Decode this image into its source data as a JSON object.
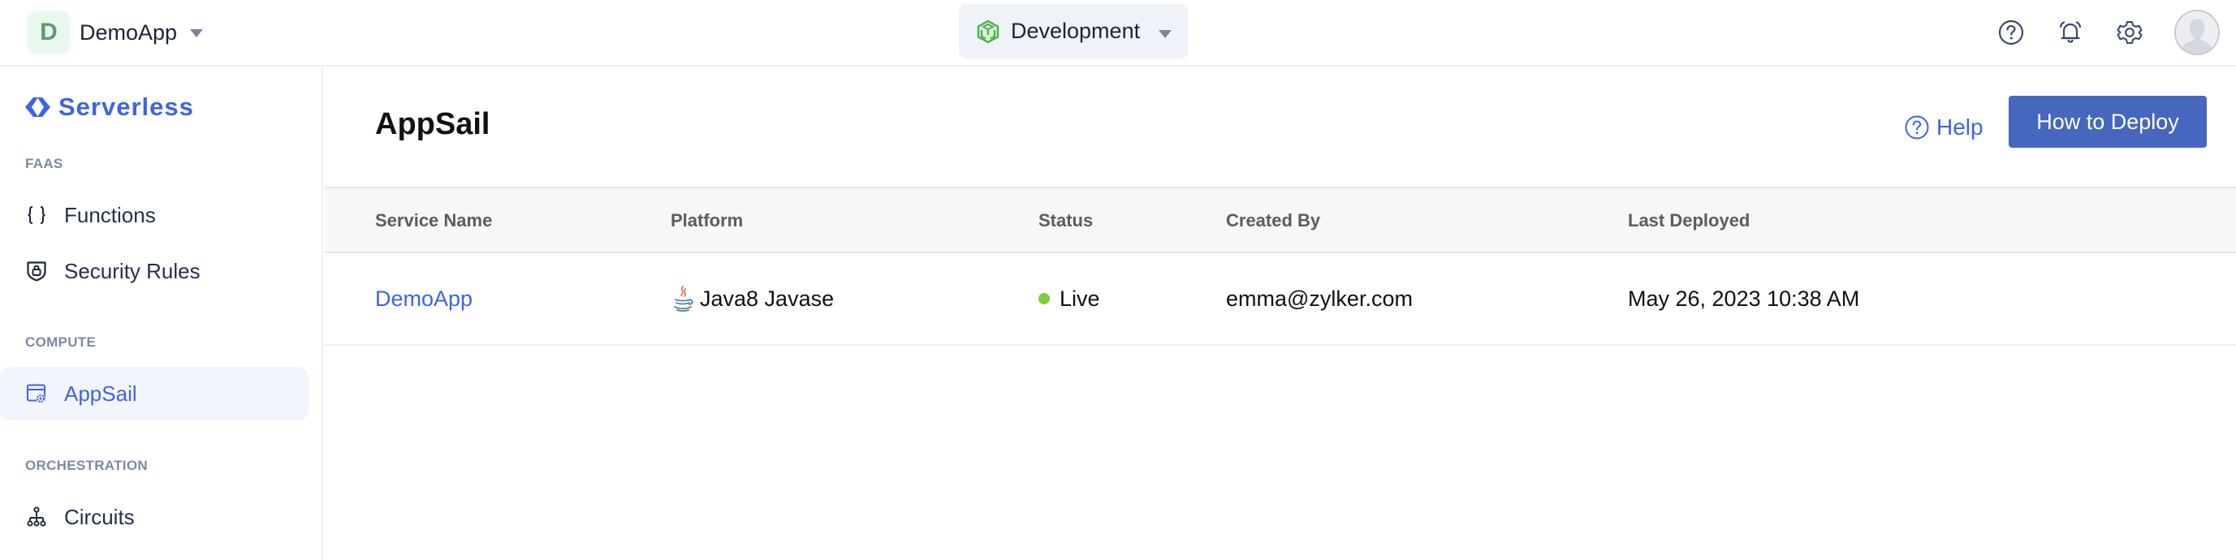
{
  "header": {
    "app_initial": "D",
    "app_name": "DemoApp",
    "environment": "Development",
    "icons": [
      "help-icon",
      "bell-icon",
      "gear-icon",
      "avatar"
    ]
  },
  "sidebar": {
    "brand": "Serverless",
    "sections": [
      {
        "label": "FAAS",
        "items": [
          {
            "label": "Functions",
            "icon": "braces-icon"
          },
          {
            "label": "Security Rules",
            "icon": "shield-lock-icon"
          }
        ]
      },
      {
        "label": "COMPUTE",
        "items": [
          {
            "label": "AppSail",
            "icon": "window-gear-icon",
            "active": true
          }
        ]
      },
      {
        "label": "ORCHESTRATION",
        "items": [
          {
            "label": "Circuits",
            "icon": "hierarchy-icon"
          }
        ]
      }
    ]
  },
  "main": {
    "title": "AppSail",
    "help_label": "Help",
    "deploy_label": "How to Deploy",
    "table": {
      "columns": [
        "Service Name",
        "Platform",
        "Status",
        "Created By",
        "Last Deployed"
      ],
      "rows": [
        {
          "service_name": "DemoApp",
          "platform": "Java8 Javase",
          "status": "Live",
          "created_by": "emma@zylker.com",
          "last_deployed": "May 26, 2023 10:38 AM"
        }
      ]
    }
  },
  "colors": {
    "accent": "#3d64e6",
    "primary_button": "#4767be",
    "status_live": "#7ccf3a",
    "app_badge_bg": "#e8f8ee"
  }
}
